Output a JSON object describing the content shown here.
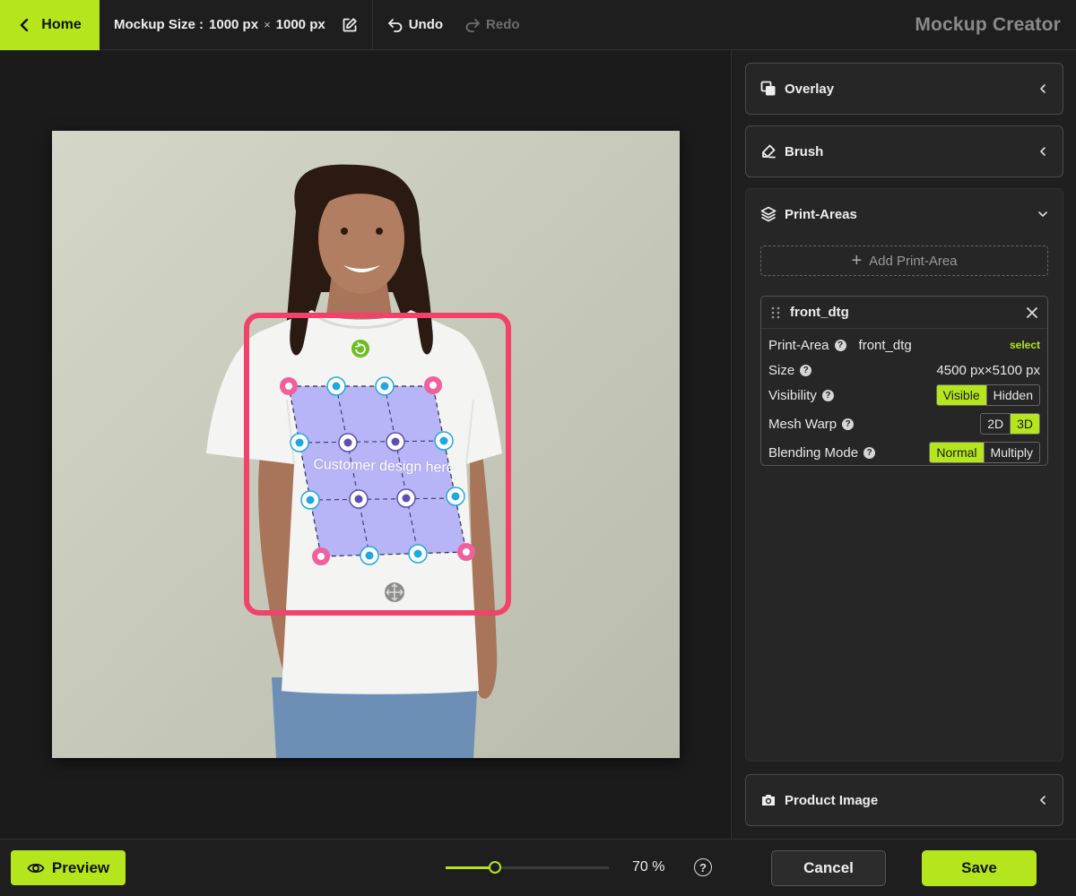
{
  "topbar": {
    "home_label": "Home",
    "mockup_size_label": "Mockup Size :",
    "mockup_width": "1000 px",
    "mockup_times": "×",
    "mockup_height": "1000 px",
    "undo_label": "Undo",
    "redo_label": "Redo",
    "app_title": "Mockup Creator"
  },
  "canvas": {
    "design_placeholder": "Customer design here"
  },
  "panel": {
    "overlay_title": "Overlay",
    "brush_title": "Brush",
    "print_areas_title": "Print-Areas",
    "add_print_area_label": "Add Print-Area",
    "product_image_title": "Product Image",
    "print_area": {
      "name": "front_dtg",
      "print_area_label": "Print-Area",
      "print_area_value": "front_dtg",
      "select_label": "select",
      "size_label": "Size",
      "size_width": "4500 px",
      "size_times": "×",
      "size_height": "5100 px",
      "visibility_label": "Visibility",
      "visibility_options": [
        "Visible",
        "Hidden"
      ],
      "visibility_selected": "Visible",
      "mesh_warp_label": "Mesh Warp",
      "mesh_warp_options": [
        "2D",
        "3D"
      ],
      "mesh_warp_selected": "3D",
      "blending_label": "Blending Mode",
      "blending_options": [
        "Normal",
        "Multiply"
      ],
      "blending_selected": "Normal"
    }
  },
  "bottombar": {
    "preview_label": "Preview",
    "zoom_percent": 70,
    "zoom_min": 0,
    "zoom_max": 200,
    "zoom_display": "70 %",
    "help_glyph": "?",
    "cancel_label": "Cancel",
    "save_label": "Save"
  },
  "colors": {
    "accent": "#b5e61d",
    "highlight_frame": "#f0426a",
    "corner_handle": "#f0609c",
    "edge_handle": "#1fa8e0",
    "inner_handle": "#5b4fb3",
    "design_fill": "#b3b0f7"
  },
  "icons": {
    "home": "chevron-left-icon",
    "edit": "edit-icon",
    "undo": "undo-icon",
    "redo": "redo-icon",
    "overlay": "overlay-icon",
    "brush": "brush-icon",
    "print_areas": "layers-icon",
    "product_image": "camera-icon",
    "preview": "eye-icon",
    "rotate": "rotate-icon",
    "move": "move-icon"
  }
}
